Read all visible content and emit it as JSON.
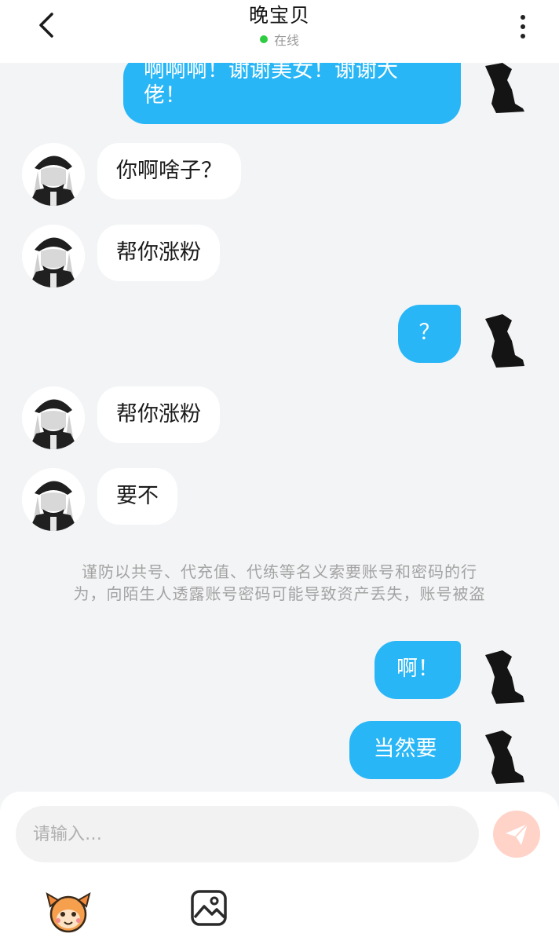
{
  "header": {
    "title": "晚宝贝",
    "status": "在线",
    "status_color": "#2ecc40"
  },
  "messages": [
    {
      "side": "right",
      "text_line1": "啊啊啊！谢谢美女！谢谢大",
      "text_line2": "佬！"
    },
    {
      "side": "left",
      "text": "你啊啥子？"
    },
    {
      "side": "left",
      "text": "帮你涨粉"
    },
    {
      "side": "right",
      "text": "？"
    },
    {
      "side": "left",
      "text": "帮你涨粉"
    },
    {
      "side": "left",
      "text": "要不"
    },
    {
      "side": "right",
      "text": "啊！"
    },
    {
      "side": "right",
      "text": "当然要"
    }
  ],
  "notice": {
    "line1": "谨防以共号、代充值、代练等名义索要账号和密码的行",
    "line2": "为，向陌生人透露账号密码可能导致资产丢失，账号被盗"
  },
  "composer": {
    "placeholder": "请输入…"
  },
  "icons": {
    "back": "chevron-left-icon",
    "more": "more-vertical-icon",
    "send": "send-icon",
    "emoji": "mascot-emoji-icon",
    "image": "image-icon"
  },
  "colors": {
    "accent": "#29b6f6",
    "send_button": "#ffd3c8",
    "background": "#f3f4f6"
  }
}
